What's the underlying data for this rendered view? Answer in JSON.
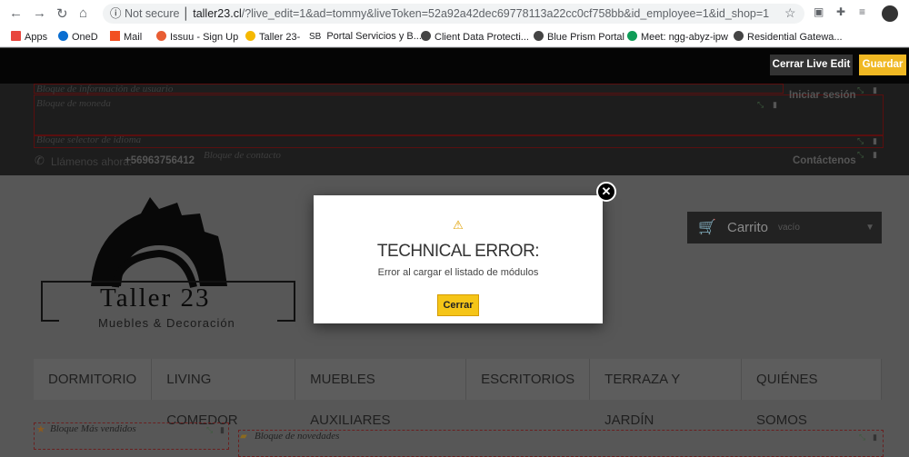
{
  "browser": {
    "security": "Not secure",
    "host": "taller23.cl",
    "path": "/?live_edit=1&ad=tommy&liveToken=52a92a42dec69778113a22cc0cf758bb&id_employee=1&id_shop=1",
    "bookmarks": [
      {
        "label": "Apps",
        "color": "#e8453c"
      },
      {
        "label": "OneD",
        "color": "#0a6ed1"
      },
      {
        "label": "Mail",
        "color": "#f25022"
      },
      {
        "label": "Issuu - Sign Up",
        "color": "#e85d33"
      },
      {
        "label": "Taller 23-",
        "color": "#f5b800"
      },
      {
        "label": "Portal Servicios y B...",
        "color": "#ffffff",
        "prefix": "SB"
      },
      {
        "label": "Client Data Protecti...",
        "color": "#444"
      },
      {
        "label": "Blue Prism Portal",
        "color": "#444"
      },
      {
        "label": "Meet: ngg-abyz-ipw",
        "color": "#0f9d58"
      },
      {
        "label": "Residential Gatewa...",
        "color": "#444"
      }
    ]
  },
  "liveedit": {
    "close": "Cerrar Live Edit",
    "save": "Guardar"
  },
  "header": {
    "user_block": "Bloque de información de usuario",
    "currency_block": "Bloque de moneda",
    "language_block": "Bloque selector de idioma",
    "contact_block": "Bloque de contacto",
    "call_label": "Llámenos ahora:",
    "phone": "+56963756412",
    "login": "Iniciar sesión",
    "contact": "Contáctenos"
  },
  "logo": {
    "name": "Taller 23",
    "tagline": "Muebles & Decoración"
  },
  "cart": {
    "label": "Carrito",
    "status": "vacío"
  },
  "menu": [
    "DORMITORIO",
    "LIVING COMEDOR",
    "MUEBLES AUXILIARES",
    "ESCRITORIOS",
    "TERRAZA Y JARDÍN",
    "QUIÉNES SOMOS"
  ],
  "blocks": {
    "bestsellers": "Bloque Más vendidos",
    "new": "Bloque de novedades"
  },
  "modal": {
    "title": "TECHNICAL ERROR:",
    "message": "Error al cargar el listado de módulos",
    "button": "Cerrar"
  }
}
